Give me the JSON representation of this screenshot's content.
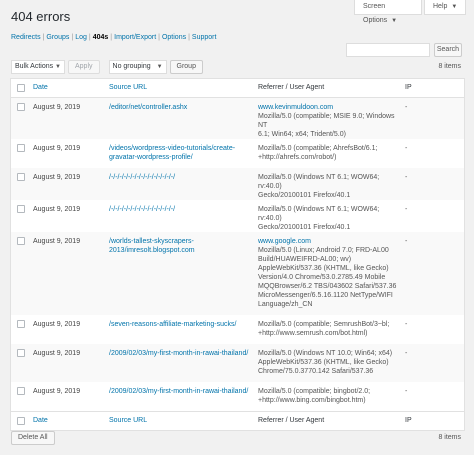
{
  "top_buttons": {
    "screen_options": "Screen Options",
    "help": "Help"
  },
  "page_title": "404 errors",
  "nav": {
    "items": [
      "Redirects",
      "Groups",
      "Log",
      "404s",
      "Import/Export",
      "Options",
      "Support"
    ],
    "current_index": 3,
    "separator": "|"
  },
  "search": {
    "placeholder": "",
    "button": "Search"
  },
  "tablenav": {
    "bulk_actions": "Bulk Actions",
    "apply": "Apply",
    "grouping": "No grouping",
    "group": "Group",
    "item_count": "8 items",
    "delete_all": "Delete All"
  },
  "columns": {
    "date": "Date",
    "source_url": "Source URL",
    "referrer": "Referrer / User Agent",
    "ip": "IP"
  },
  "rows": [
    {
      "date": "August 9, 2019",
      "url": [
        "/editor/net/controller.ashx"
      ],
      "referrer": "www.kevinmuldoon.com",
      "agent": [
        "Mozilla/5.0 (compatible; MSIE 9.0; Windows NT",
        "6.1; Win64; x64; Trident/5.0)"
      ],
      "ip": "-"
    },
    {
      "date": "August 9, 2019",
      "url": [
        "/videos/wordpress-video-tutorials/create-",
        "gravatar-wordpress-profile/"
      ],
      "referrer": "",
      "agent": [
        "Mozilla/5.0 (compatible; AhrefsBot/6.1;",
        "+http://ahrefs.com/robot/)"
      ],
      "ip": "-"
    },
    {
      "date": "August 9, 2019",
      "url": [
        "/-/-/-/-/-/-/-/-/-/-/-/-/-/-/-/"
      ],
      "referrer": "",
      "agent": [
        "Mozilla/5.0 (Windows NT 6.1; WOW64; rv:40.0)",
        "Gecko/20100101 Firefox/40.1"
      ],
      "ip": "-"
    },
    {
      "date": "August 9, 2019",
      "url": [
        "/-/-/-/-/-/-/-/-/-/-/-/-/-/-/-/"
      ],
      "referrer": "",
      "agent": [
        "Mozilla/5.0 (Windows NT 6.1; WOW64; rv:40.0)",
        "Gecko/20100101 Firefox/40.1"
      ],
      "ip": "-"
    },
    {
      "date": "August 9, 2019",
      "url": [
        "/worlds-tallest-skyscrapers-",
        "2013/imresolt.blogspot.com"
      ],
      "referrer": "www.google.com",
      "agent": [
        "Mozilla/5.0 (Linux; Android 7.0; FRD-AL00",
        "Build/HUAWEIFRD-AL00; wv)",
        "AppleWebKit/537.36 (KHTML, like Gecko)",
        "Version/4.0 Chrome/53.0.2785.49 Mobile",
        "MQQBrowser/6.2 TBS/043602 Safari/537.36",
        "MicroMessenger/6.5.16.1120 NetType/WIFI",
        "Language/zh_CN"
      ],
      "ip": "-"
    },
    {
      "date": "August 9, 2019",
      "url": [
        "/seven-reasons-affiliate-marketing-sucks/"
      ],
      "referrer": "",
      "agent": [
        "Mozilla/5.0 (compatible; SemrushBot/3~bl;",
        "+http://www.semrush.com/bot.html)"
      ],
      "ip": "-"
    },
    {
      "date": "August 9, 2019",
      "url": [
        "/2009/02/03/my-first-month-in-rawai-thailand/"
      ],
      "referrer": "",
      "agent": [
        "Mozilla/5.0 (Windows NT 10.0; Win64; x64)",
        "AppleWebKit/537.36 (KHTML, like Gecko)",
        "Chrome/75.0.3770.142 Safari/537.36"
      ],
      "ip": "-"
    },
    {
      "date": "August 9, 2019",
      "url": [
        "/2009/02/03/my-first-month-in-rawai-thailand/"
      ],
      "referrer": "",
      "agent": [
        "Mozilla/5.0 (compatible; bingbot/2.0;",
        "+http://www.bing.com/bingbot.htm)"
      ],
      "ip": "-"
    }
  ]
}
